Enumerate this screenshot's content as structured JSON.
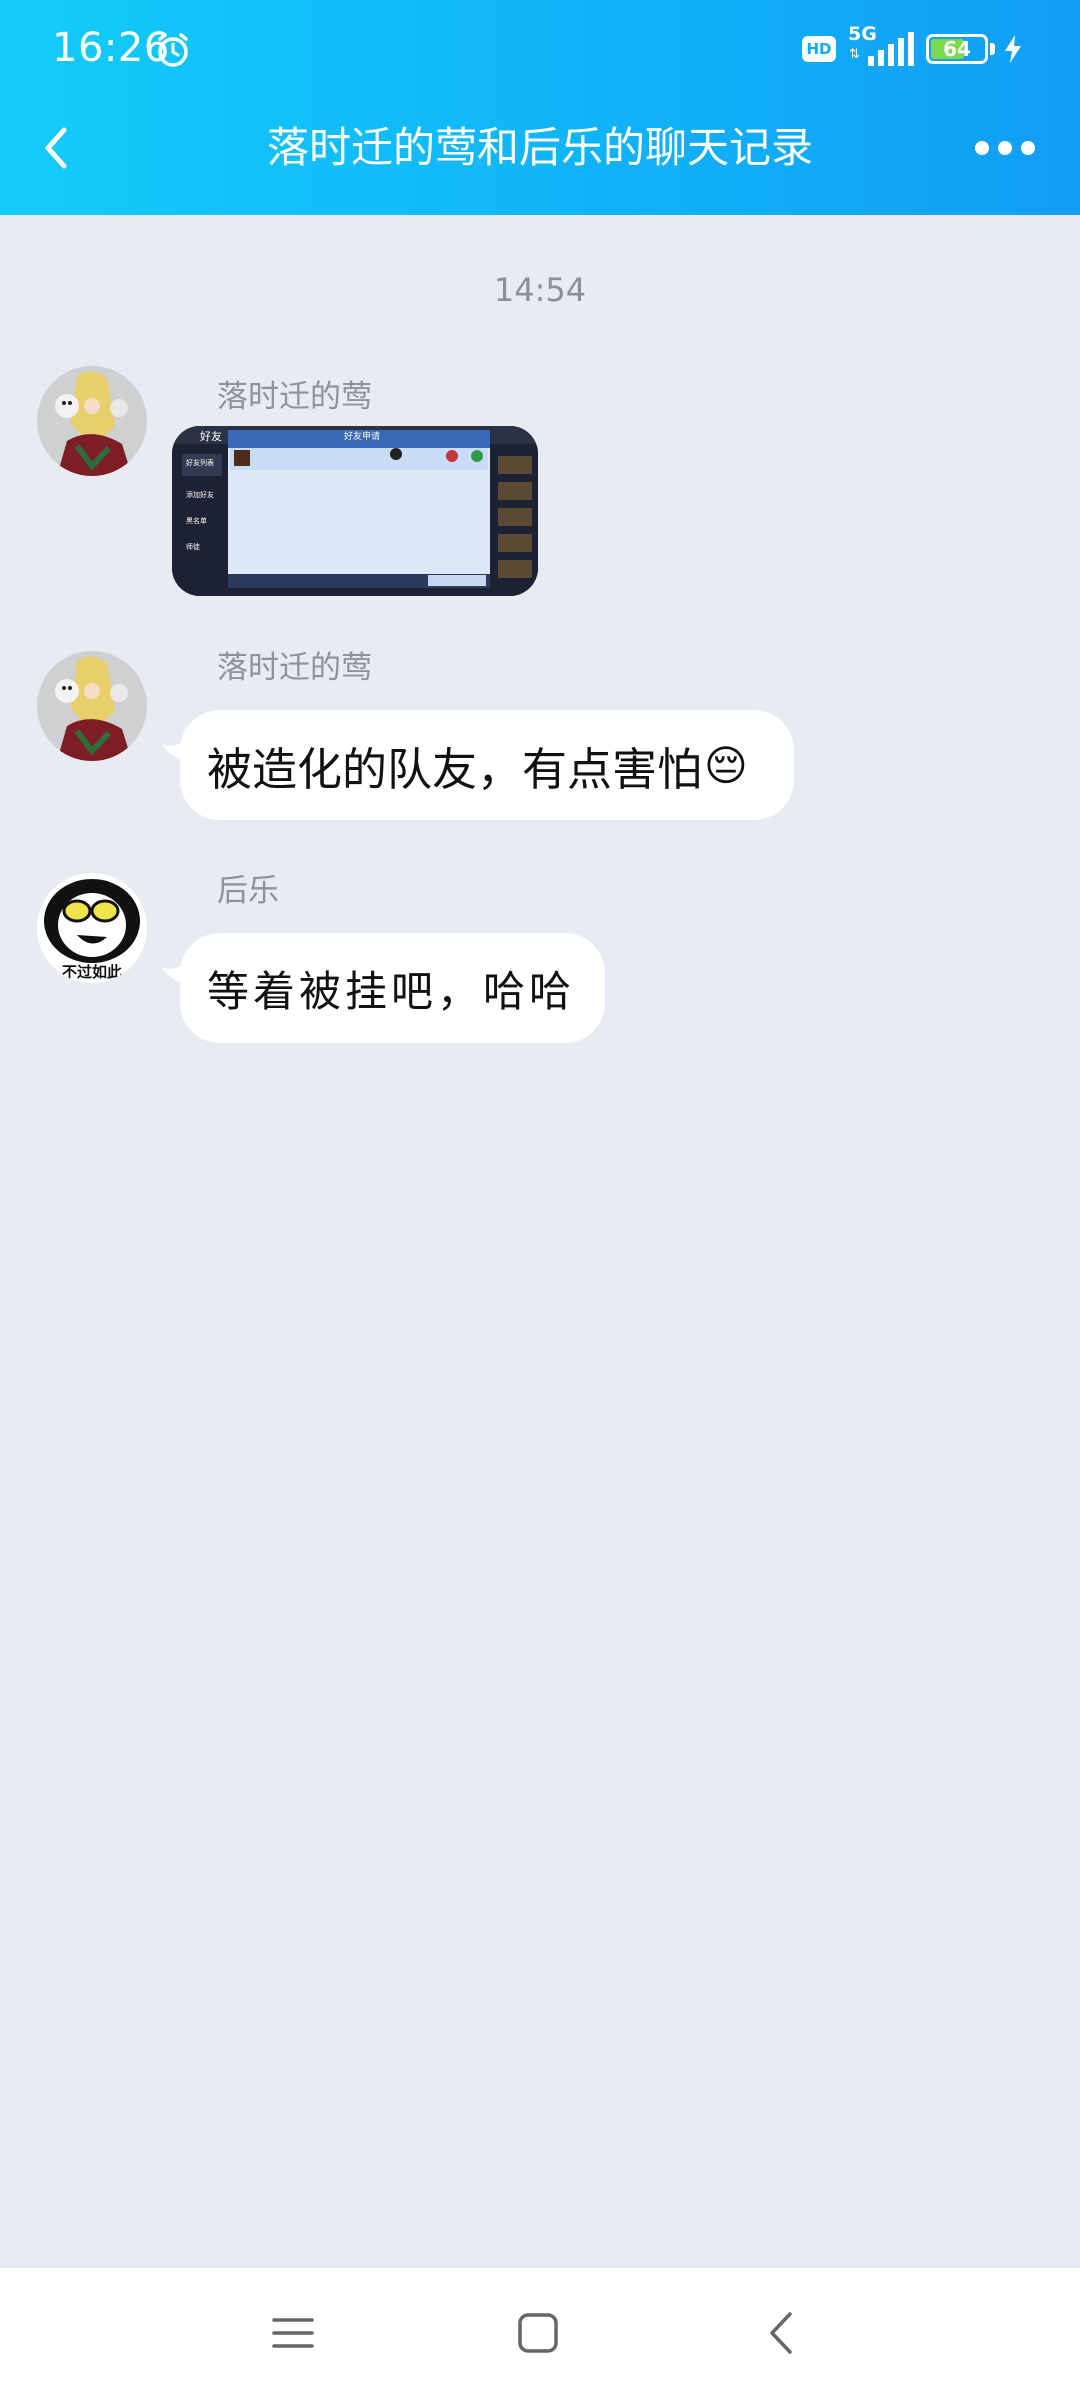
{
  "status_bar": {
    "time": "16:26",
    "hd_badge": "HD",
    "network": "5G",
    "battery_level": 64,
    "battery_text": "64",
    "icons": [
      "alarm-icon",
      "signal-icon",
      "battery-icon",
      "charging-icon"
    ]
  },
  "header": {
    "title": "落时迁的莺和后乐的聊天记录",
    "back_icon": "chevron-left-icon",
    "more_icon": "more-dots-icon",
    "gradient_colors": [
      "#14ccfb",
      "#119ef5"
    ]
  },
  "chat": {
    "timestamp": "14:54",
    "messages": [
      {
        "sender": "落时迁的莺",
        "type": "image",
        "avatar": "anime-avatar"
      },
      {
        "sender": "落时迁的莺",
        "type": "text",
        "text": "被造化的队友，有点害怕",
        "emoji": "😔",
        "avatar": "anime-avatar"
      },
      {
        "sender": "后乐",
        "type": "text",
        "text": "等着被挂吧，哈哈",
        "avatar": "panda-meme-avatar",
        "avatar_caption": "不过如此"
      }
    ]
  },
  "image_preview": {
    "header": "好友申请",
    "sidebar_tab": "好友",
    "sidebar_items": [
      "好友列表",
      "添加好友",
      "黑名单",
      "师徒"
    ]
  },
  "bottom_nav": {
    "icons": [
      "menu-icon",
      "home-square-icon",
      "back-chevron-icon"
    ]
  }
}
